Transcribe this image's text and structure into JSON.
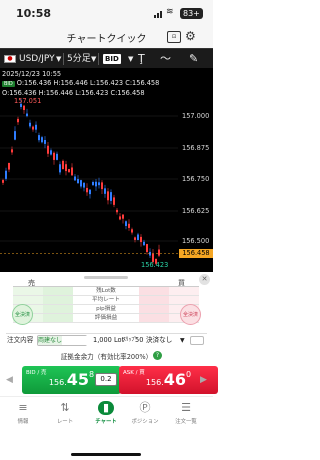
{
  "status_bar": {
    "time": "10:58",
    "wifi_icon": "wifi-icon",
    "battery": "83+"
  },
  "nav": {
    "title": "チャートクイック",
    "icon_left": "settings-panel-icon",
    "icon_right": "gear-icon"
  },
  "toolbar": {
    "flag_icon": "japan-us-flag-icon",
    "pair": "USD/JPY",
    "timeframe": "5分足",
    "price_type": "BID",
    "icons": [
      "text-icon",
      "wave-icon",
      "pen-icon"
    ]
  },
  "chart": {
    "datetime": "2025/12/23 10:55",
    "bid_tag": "BID",
    "ohlc_line": "O:156.436 H:156.446 L:156.423 C:156.458",
    "ohlc_line2": "O:156.436 H:156.446 L:156.423 C:156.458",
    "high_label": "157.051",
    "low_label": "156.423",
    "current_price": "156.458",
    "price_labels": [
      "157.000",
      "156.875",
      "156.750",
      "156.625",
      "156.500"
    ],
    "colors": {
      "up": "#ff3b3b",
      "down": "#2f7dff",
      "background": "#000000",
      "current": "#f5a623"
    }
  },
  "chart_data": {
    "type": "candlestick",
    "y_axis_ticks": [
      157.0,
      156.875,
      156.75,
      156.625,
      156.5
    ],
    "high_marker": 157.051,
    "low_marker": 156.423,
    "last": 156.458
  },
  "panel": {
    "sell_label": "売",
    "buy_label": "買",
    "rows": [
      "残Lot数",
      "平均レート",
      "pip損益",
      "評価損益"
    ],
    "sell_close": "全決済",
    "buy_close": "全決済",
    "order_type": "注文内容",
    "toggle_on": "両建なし",
    "toggle_off": "",
    "lot": "1,000 Lot",
    "slip_label": "ｽﾘｯﾌﾟ",
    "slip_value": "50",
    "settle": "決済なし",
    "margin": "証拠金余力（有効比率200%）",
    "help_icon": "question-icon"
  },
  "trade": {
    "bid_label": "BID / 売",
    "bid_price_small": "156.",
    "bid_price_big": "45",
    "bid_price_sup": "8",
    "ask_label": "ASK / 買",
    "ask_price_small": "156.",
    "ask_price_big": "46",
    "ask_price_sup": "0",
    "spread": "0.2"
  },
  "tabs": [
    {
      "icon": "menu-icon",
      "label": "情報"
    },
    {
      "icon": "rate-icon",
      "label": "レート"
    },
    {
      "icon": "chart-icon",
      "label": "チャート",
      "active": true
    },
    {
      "icon": "position-icon",
      "label": "ポジション"
    },
    {
      "icon": "list-icon",
      "label": "注文一覧"
    }
  ]
}
